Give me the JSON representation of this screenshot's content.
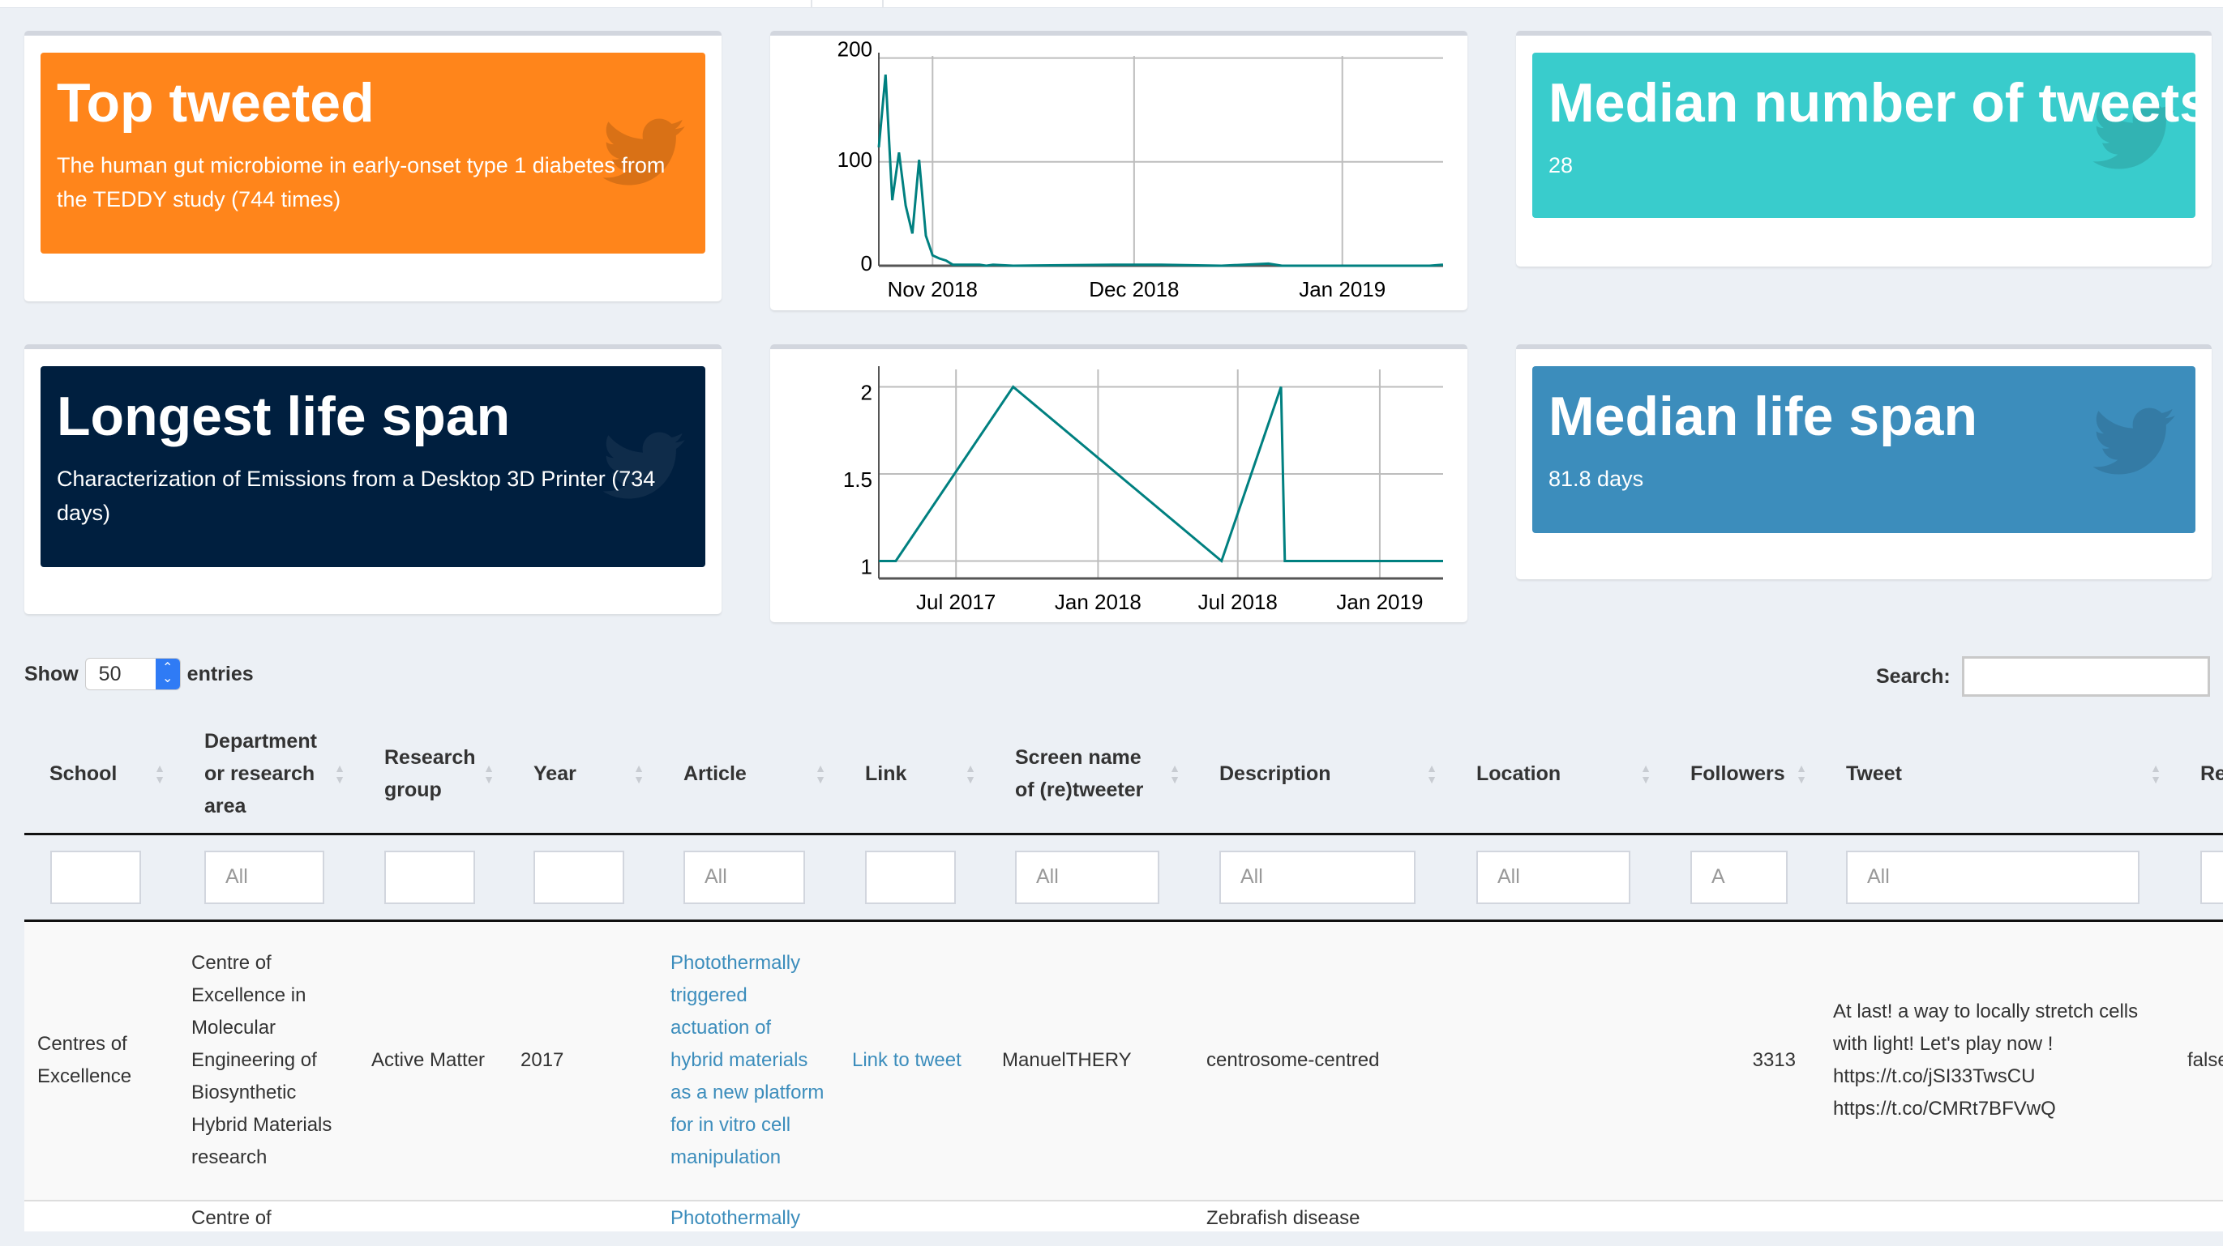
{
  "kpis": [
    {
      "title": "Top tweeted",
      "text": "The human gut microbiome in early-onset type 1 diabetes from the TEDDY study (744 times)",
      "color": "#ff851b",
      "icon": "twitter-bird-icon"
    },
    {
      "title": "Median number of tweets",
      "text": "28",
      "color": "#39cccc",
      "icon": "twitter-bird-icon"
    },
    {
      "title": "Longest life span",
      "text": "Characterization of Emissions from a Desktop 3D Printer (734 days)",
      "color": "#001f3f",
      "icon": "twitter-bird-icon"
    },
    {
      "title": "Median life span",
      "text": "81.8 days",
      "color": "#3c8dbc",
      "icon": "twitter-bird-icon"
    }
  ],
  "chart_data": [
    {
      "type": "line",
      "line_color": "#008080",
      "grid": true,
      "ylim": [
        0,
        202
      ],
      "xlim": [
        "2018-10-24",
        "2019-01-16"
      ],
      "yticks": [
        {
          "v": 0,
          "label": "0"
        },
        {
          "v": 100,
          "label": "100"
        },
        {
          "v": 200,
          "label": "200"
        }
      ],
      "xticks": [
        {
          "d": "2018-11-01",
          "label": "Nov 2018"
        },
        {
          "d": "2018-12-01",
          "label": "Dec 2018"
        },
        {
          "d": "2019-01-01",
          "label": "Jan 2019"
        }
      ],
      "points": [
        [
          "2018-10-24",
          114
        ],
        [
          "2018-10-25",
          184
        ],
        [
          "2018-10-26",
          63
        ],
        [
          "2018-10-27",
          109
        ],
        [
          "2018-10-28",
          58
        ],
        [
          "2018-10-29",
          31
        ],
        [
          "2018-10-30",
          102
        ],
        [
          "2018-10-31",
          29
        ],
        [
          "2018-11-01",
          10
        ],
        [
          "2018-11-02",
          7
        ],
        [
          "2018-11-03",
          5
        ],
        [
          "2018-11-04",
          1
        ],
        [
          "2018-11-08",
          1
        ],
        [
          "2018-11-09",
          0
        ],
        [
          "2018-11-10",
          1
        ],
        [
          "2018-11-13",
          0
        ],
        [
          "2018-11-28",
          1
        ],
        [
          "2018-12-05",
          1
        ],
        [
          "2018-12-14",
          0
        ],
        [
          "2018-12-21",
          2
        ],
        [
          "2018-12-23",
          0
        ],
        [
          "2019-01-14",
          0
        ],
        [
          "2019-01-16",
          1
        ]
      ]
    },
    {
      "type": "line",
      "line_color": "#008080",
      "grid": true,
      "ylim": [
        0.9,
        2.1
      ],
      "xlim": [
        "2017-03-23",
        "2019-03-24"
      ],
      "yticks": [
        {
          "v": 1,
          "label": "1"
        },
        {
          "v": 1.5,
          "label": "1.5"
        },
        {
          "v": 2,
          "label": "2"
        }
      ],
      "xticks": [
        {
          "d": "2017-07-01",
          "label": "Jul 2017"
        },
        {
          "d": "2018-01-01",
          "label": "Jan 2018"
        },
        {
          "d": "2018-07-01",
          "label": "Jul 2018"
        },
        {
          "d": "2019-01-01",
          "label": "Jan 2019"
        }
      ],
      "points": [
        [
          "2017-03-23",
          1
        ],
        [
          "2017-04-14",
          1
        ],
        [
          "2017-09-13",
          2
        ],
        [
          "2018-06-10",
          1
        ],
        [
          "2018-08-26",
          2
        ],
        [
          "2018-08-31",
          1
        ],
        [
          "2019-03-24",
          1
        ]
      ]
    }
  ],
  "table": {
    "length_label_pre": "Show",
    "length_value": "50",
    "length_label_post": "entries",
    "search_label": "Search:",
    "search_value": "",
    "columns": [
      "School",
      "Department or research area",
      "Research group",
      "Year",
      "Article",
      "Link",
      "Screen name of (re)tweeter",
      "Description",
      "Location",
      "Followers",
      "Tweet",
      "Re"
    ],
    "filters": [
      "",
      "All",
      "",
      "",
      "All",
      "",
      "All",
      "All",
      "All",
      "A",
      "All",
      ""
    ],
    "rows": [
      [
        "Centres of Excellence",
        "Centre of Excellence in Molecular Engineering of Biosynthetic Hybrid Materials research",
        "Active Matter",
        "2017",
        "Photothermally triggered actuation of hybrid materials as a new platform for in vitro cell manipulation",
        "Link to tweet",
        "ManuelTHERY",
        "centrosome-centred",
        "",
        "3313",
        "At last! a way to locally stretch cells with light! Let's play now ! https://t.co/jSI33TwsCU https://t.co/CMRt7BFVwQ",
        "false"
      ],
      [
        "",
        "Centre of",
        "",
        "",
        "Photothermally",
        "",
        "",
        "Zebrafish disease",
        "",
        "",
        "",
        ""
      ]
    ]
  }
}
